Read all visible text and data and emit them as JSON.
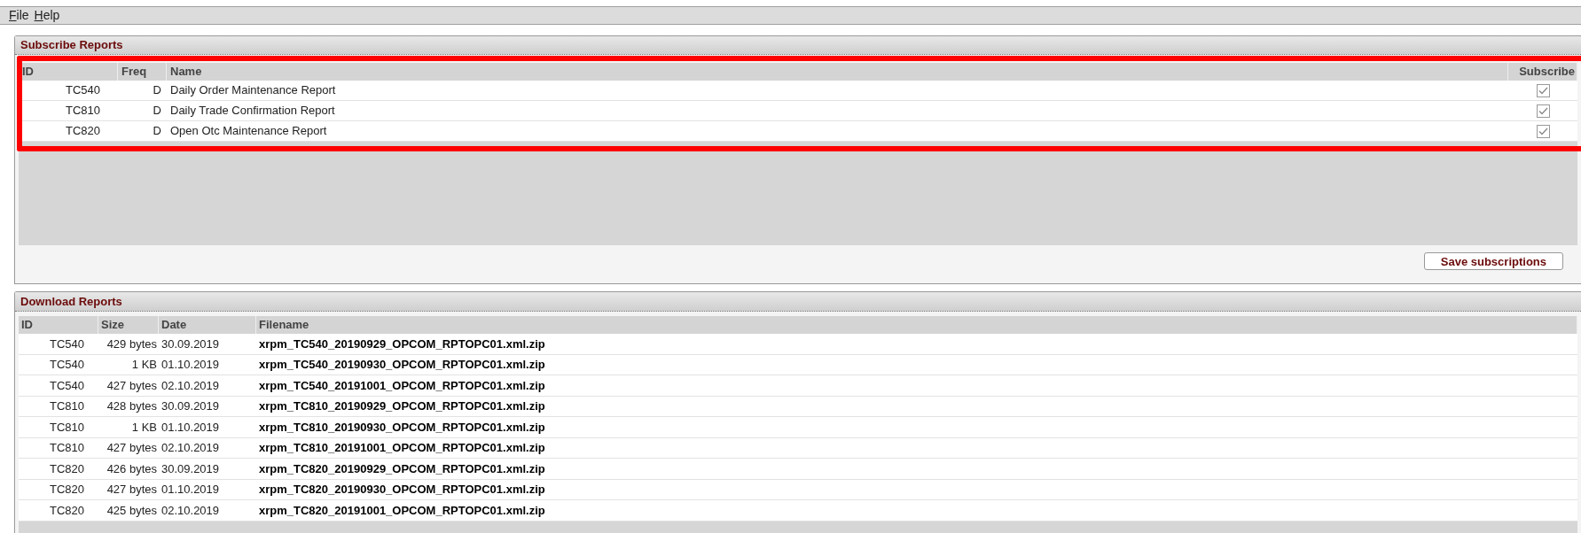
{
  "menu": [
    {
      "label": "File"
    },
    {
      "label": "Help"
    }
  ],
  "subscribe_panel": {
    "title": "Subscribe Reports",
    "columns": [
      "ID",
      "Freq",
      "Name",
      "Subscribe"
    ],
    "rows": [
      {
        "id": "TC540",
        "freq": "D",
        "name": "Daily Order Maintenance Report",
        "checked": true
      },
      {
        "id": "TC810",
        "freq": "D",
        "name": "Daily Trade Confirmation Report",
        "checked": true
      },
      {
        "id": "TC820",
        "freq": "D",
        "name": "Open Otc Maintenance Report",
        "checked": true
      }
    ],
    "button": "Save subscriptions"
  },
  "download_panel": {
    "title": "Download Reports",
    "columns": [
      "ID",
      "Size",
      "Date",
      "Filename"
    ],
    "rows": [
      {
        "id": "TC540",
        "size": "429 bytes",
        "date": "30.09.2019",
        "filename": "xrpm_TC540_20190929_OPCOM_RPTOPC01.xml.zip"
      },
      {
        "id": "TC540",
        "size": "1 KB",
        "date": "01.10.2019",
        "filename": "xrpm_TC540_20190930_OPCOM_RPTOPC01.xml.zip"
      },
      {
        "id": "TC540",
        "size": "427 bytes",
        "date": "02.10.2019",
        "filename": "xrpm_TC540_20191001_OPCOM_RPTOPC01.xml.zip"
      },
      {
        "id": "TC810",
        "size": "428 bytes",
        "date": "30.09.2019",
        "filename": "xrpm_TC810_20190929_OPCOM_RPTOPC01.xml.zip"
      },
      {
        "id": "TC810",
        "size": "1 KB",
        "date": "01.10.2019",
        "filename": "xrpm_TC810_20190930_OPCOM_RPTOPC01.xml.zip"
      },
      {
        "id": "TC810",
        "size": "427 bytes",
        "date": "02.10.2019",
        "filename": "xrpm_TC810_20191001_OPCOM_RPTOPC01.xml.zip"
      },
      {
        "id": "TC820",
        "size": "426 bytes",
        "date": "30.09.2019",
        "filename": "xrpm_TC820_20190929_OPCOM_RPTOPC01.xml.zip"
      },
      {
        "id": "TC820",
        "size": "427 bytes",
        "date": "01.10.2019",
        "filename": "xrpm_TC820_20190930_OPCOM_RPTOPC01.xml.zip"
      },
      {
        "id": "TC820",
        "size": "425 bytes",
        "date": "02.10.2019",
        "filename": "xrpm_TC820_20191001_OPCOM_RPTOPC01.xml.zip"
      }
    ]
  }
}
